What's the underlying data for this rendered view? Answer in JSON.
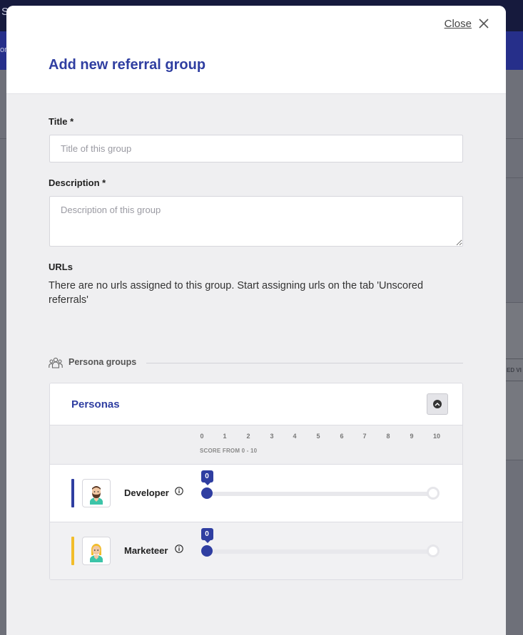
{
  "background": {
    "topbar_text": "S",
    "bluebar_text": "on",
    "chip_text": "ED VI"
  },
  "modal": {
    "close_label": "Close",
    "title": "Add new referral group",
    "title_field": {
      "label": "Title *",
      "placeholder": "Title of this group",
      "value": ""
    },
    "description_field": {
      "label": "Description *",
      "placeholder": "Description of this group",
      "value": ""
    },
    "urls": {
      "label": "URLs",
      "text": "There are no urls assigned to this group. Start assigning urls on the tab 'Unscored referrals'"
    },
    "persona_groups": {
      "label": "Persona groups",
      "icon": "people-group-icon",
      "panel_title": "Personas",
      "scale": {
        "ticks": [
          "0",
          "1",
          "2",
          "3",
          "4",
          "5",
          "6",
          "7",
          "8",
          "9",
          "10"
        ],
        "caption": "SCORE FROM 0 - 10",
        "min": 0,
        "max": 10
      },
      "personas": [
        {
          "name": "Developer",
          "score": 0,
          "score_label": "0",
          "color": "#2f3ea1",
          "avatar": "developer-avatar-icon"
        },
        {
          "name": "Marketeer",
          "score": 0,
          "score_label": "0",
          "color": "#f2bd2b",
          "avatar": "marketeer-avatar-icon"
        }
      ]
    }
  },
  "colors": {
    "accent": "#2f3ea1",
    "developer": "#2f3ea1",
    "marketeer": "#f2bd2b"
  }
}
